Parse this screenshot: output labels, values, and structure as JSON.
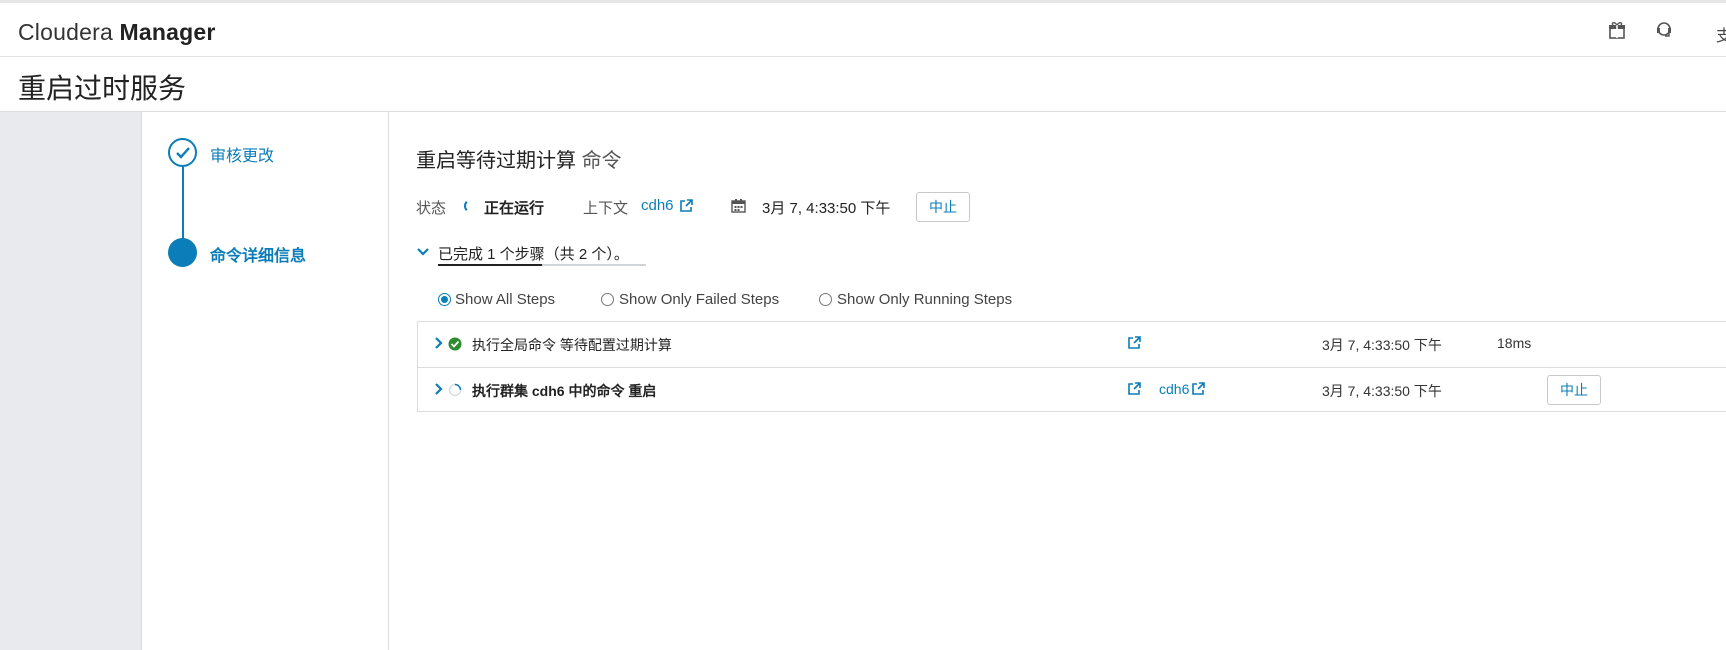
{
  "header": {
    "brand_light": "Cloudera",
    "brand_bold": "Manager",
    "icons": [
      "gift-icon",
      "support-icon"
    ],
    "truncated_text": "支"
  },
  "page": {
    "title": "重启过时服务"
  },
  "wizard": {
    "steps": [
      {
        "label": "审核更改",
        "state": "completed"
      },
      {
        "label": "命令详细信息",
        "state": "current"
      }
    ]
  },
  "command": {
    "title": "重启等待过期计算",
    "title_suffix": "命令",
    "status_label": "状态",
    "status_value": "正在运行",
    "context_label": "上下文",
    "context_value": "cdh6",
    "timestamp": "3月 7, 4:33:50 下午",
    "abort_label": "中止"
  },
  "progress": {
    "summary": "已完成 1 个步骤（共 2 个）。",
    "completed": 1,
    "total": 2
  },
  "filters": [
    {
      "label": "Show All Steps",
      "checked": true
    },
    {
      "label": "Show Only Failed Steps",
      "checked": false
    },
    {
      "label": "Show Only Running Steps",
      "checked": false
    }
  ],
  "steps": [
    {
      "name": "执行全局命令 等待配置过期计算",
      "status": "success",
      "context": "",
      "time": "3月 7, 4:33:50 下午",
      "duration": "18ms",
      "action": ""
    },
    {
      "name": "执行群集 cdh6 中的命令 重启",
      "status": "running",
      "context": "cdh6",
      "time": "3月 7, 4:33:50 下午",
      "duration": "",
      "action": "中止"
    }
  ],
  "colors": {
    "accent": "#0b7db8",
    "success": "#2e8b2e",
    "sidebar_gray": "#e8eaed"
  }
}
